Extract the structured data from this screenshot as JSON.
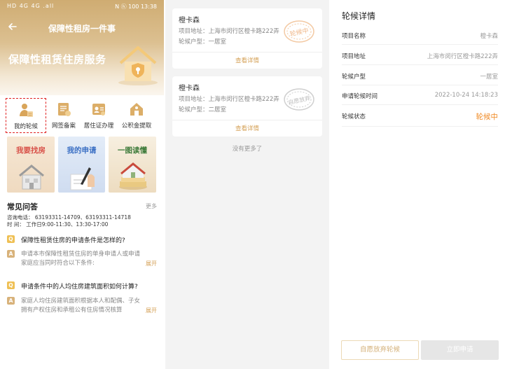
{
  "status_bar": {
    "left": "HD 4G 4G .all",
    "mid": "",
    "right": "N ⓗ 100 13:38"
  },
  "app": {
    "nav_title": "保障性租房一件事",
    "banner_title": "保障性租赁住房服务"
  },
  "menu": [
    {
      "label": "我的轮候",
      "selected": true,
      "icon": "person-doc-icon"
    },
    {
      "label": "网签备案",
      "selected": false,
      "icon": "contract-icon"
    },
    {
      "label": "居住证办理",
      "selected": false,
      "icon": "id-card-icon"
    },
    {
      "label": "公积金提取",
      "selected": false,
      "icon": "house-fund-icon"
    }
  ],
  "features": [
    {
      "label": "我要找房",
      "color": "#d8524a"
    },
    {
      "label": "我的申请",
      "color": "#3a6fc4"
    },
    {
      "label": "一图读懂",
      "color": "#3e7b3a"
    }
  ],
  "faq": {
    "title": "常见问答",
    "more": "更多",
    "phone_line": "咨询电话：  63193311-14709、63193311-14718",
    "time_line": "时      间：  工作日9:00-11:30、13:30-17:00",
    "items": [
      {
        "question": "保障性租赁住房的申请条件是怎样的?",
        "answer": "申请本市保障性租赁住房的单身申请人或申请家庭应当同时符合以下条件:",
        "expand": "展开"
      },
      {
        "question": "申请条件中的人均住房建筑面积如何计算?",
        "answer": "家庭人均住房建筑面积根据本人和配偶、子女拥有产权住房和承租公有住房情况核算",
        "expand": "展开"
      }
    ]
  },
  "queue_list": {
    "cards": [
      {
        "name": "橙卡森",
        "address_label": "项目地址：",
        "address": "上海市闵行区橙卡路222弄",
        "unit_label": "轮候户型：",
        "unit": "一居室",
        "detail_link": "查看详情",
        "stamp": "轮候中"
      },
      {
        "name": "橙卡森",
        "address_label": "项目地址：",
        "address": "上海市闵行区橙卡路222弄",
        "unit_label": "轮候户型：",
        "unit": "二居室",
        "detail_link": "查看详情",
        "stamp": "自愿放弃"
      }
    ],
    "no_more": "没有更多了"
  },
  "detail": {
    "title": "轮候详情",
    "rows": [
      {
        "key": "项目名称",
        "value": "橙卡森"
      },
      {
        "key": "项目地址",
        "value": "上海市闵行区橙卡路222弄"
      },
      {
        "key": "轮候户型",
        "value": "一居室"
      },
      {
        "key": "申请轮候时间",
        "value": "2022-10-24 14:18:23"
      },
      {
        "key": "轮候状态",
        "value": "轮候中"
      }
    ],
    "btn_abandon": "自愿放弃轮候",
    "btn_apply": "立即申请",
    "status_color": "#f08a24",
    "accent": "#d4a056"
  }
}
